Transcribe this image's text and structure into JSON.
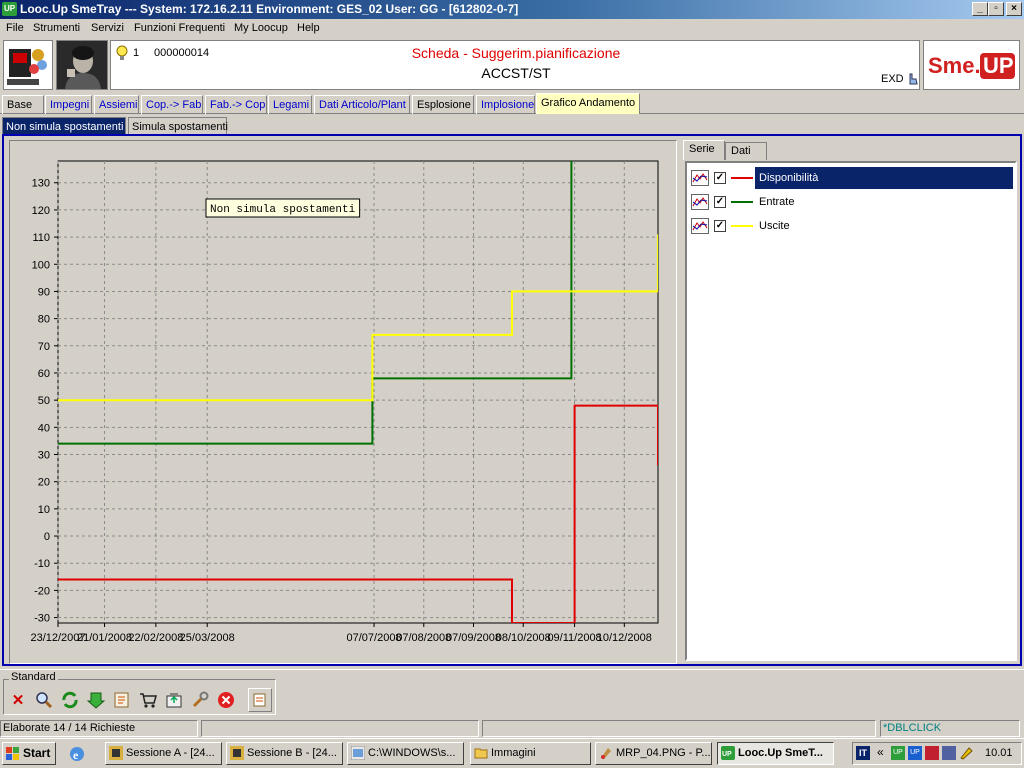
{
  "window": {
    "title": "Looc.Up SmeTray --- System: 172.16.2.11 Environment: GES_02 User: GG - [612802-0-7]",
    "app_icon": "UP"
  },
  "menu": [
    "File",
    "Strumenti",
    "Servizi",
    "Funzioni Frequenti",
    "My Loocup",
    "Help"
  ],
  "header": {
    "bulb_count": "1",
    "code": "000000014",
    "scheda_title": "Scheda - Suggerim.pianificazione",
    "item": "ACCST/ST",
    "exd": "EXD",
    "logo": "Sme.UP",
    "title_color": "#e00000"
  },
  "tabs": [
    "Base",
    "Impegni",
    "Assiemi",
    "Cop.-> Fab",
    "Fab.-> Cop",
    "Legami",
    "Dati Articolo/Plant",
    "Esplosione",
    "Implosione",
    "Grafico Andamento"
  ],
  "subtabs": [
    "Non simula spostamenti",
    "Simula spostamenti"
  ],
  "right_tabs": [
    "Serie",
    "Dati"
  ],
  "legend": [
    {
      "label": "Disponibilità",
      "color": "#e00000",
      "checked": true
    },
    {
      "label": "Entrate",
      "color": "#007000",
      "checked": true
    },
    {
      "label": "Uscite",
      "color": "#ffff00",
      "checked": true
    }
  ],
  "chart_data": {
    "type": "line",
    "annotation": "Non simula spostamenti",
    "xlabel": "",
    "ylabel": "",
    "x_tick_labels": [
      "23/12/2007",
      "21/01/2008",
      "22/02/2008",
      "25/03/2008",
      "07/07/2008",
      "07/08/2008",
      "07/09/2008",
      "08/10/2008",
      "09/11/2008",
      "10/12/2008"
    ],
    "x_range": [
      "23/12/2007",
      "31/12/2008"
    ],
    "ylim": [
      -32,
      138
    ],
    "y_ticks": [
      -30,
      -20,
      -10,
      0,
      10,
      20,
      30,
      40,
      50,
      60,
      70,
      80,
      90,
      100,
      110,
      120,
      130
    ],
    "grid": true,
    "step": true,
    "series": [
      {
        "name": "Disponibilità",
        "color": "#e00000",
        "points": [
          [
            "23/12/2007",
            -16
          ],
          [
            "01/10/2008",
            -16
          ],
          [
            "01/10/2008",
            -32
          ],
          [
            "09/11/2008",
            -32
          ],
          [
            "09/11/2008",
            48
          ],
          [
            "31/12/2008",
            48
          ],
          [
            "31/12/2008",
            26
          ]
        ]
      },
      {
        "name": "Entrate",
        "color": "#007000",
        "points": [
          [
            "23/12/2007",
            34
          ],
          [
            "06/07/2008",
            34
          ],
          [
            "06/07/2008",
            58
          ],
          [
            "07/11/2008",
            58
          ],
          [
            "07/11/2008",
            138
          ]
        ]
      },
      {
        "name": "Uscite",
        "color": "#ffff00",
        "points": [
          [
            "23/12/2007",
            50
          ],
          [
            "06/07/2008",
            50
          ],
          [
            "06/07/2008",
            74
          ],
          [
            "01/10/2008",
            74
          ],
          [
            "01/10/2008",
            90
          ],
          [
            "31/12/2008",
            90
          ],
          [
            "31/12/2008",
            111
          ]
        ]
      }
    ]
  },
  "toolbar": {
    "group_label": "Standard"
  },
  "status": {
    "left": "Elaborate 14 / 14 Richieste",
    "right": "*DBLCLICK"
  },
  "taskbar": {
    "start": "Start",
    "tasks": [
      "Sessione A - [24...",
      "Sessione B - [24...",
      "C:\\WINDOWS\\s...",
      "Immagini",
      "MRP_04.PNG - P...",
      "Looc.Up SmeT..."
    ],
    "lang": "IT",
    "clock": "10.01"
  }
}
